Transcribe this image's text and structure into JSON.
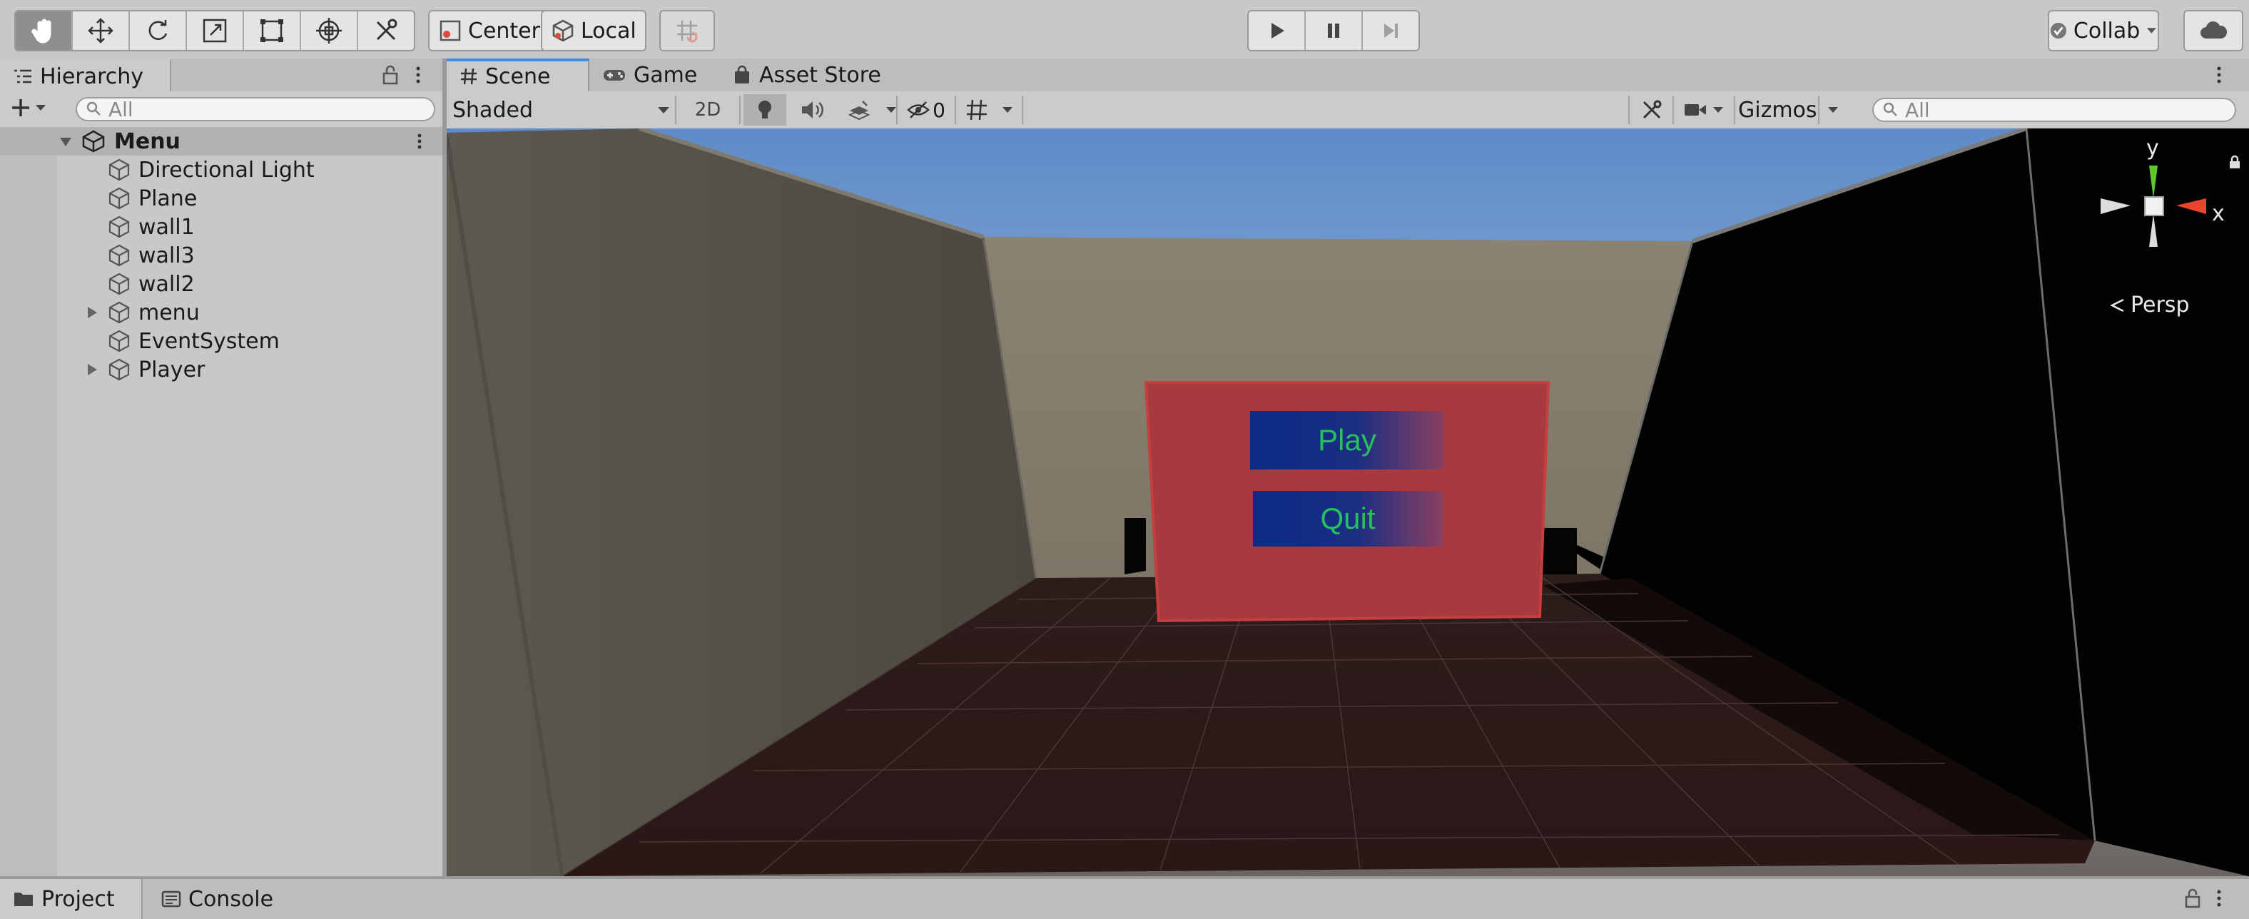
{
  "toolbar": {
    "tools": [
      "hand-tool",
      "move-tool",
      "rotate-tool",
      "scale-tool",
      "rect-tool",
      "transform-tool",
      "custom-tool"
    ],
    "pivot_label": "Center",
    "space_label": "Local",
    "collab_label": "Collab"
  },
  "hierarchy": {
    "tab_label": "Hierarchy",
    "search_placeholder": "All",
    "scene_name": "Menu",
    "items": [
      {
        "label": "Directional Light",
        "expandable": false
      },
      {
        "label": "Plane",
        "expandable": false
      },
      {
        "label": "wall1",
        "expandable": false
      },
      {
        "label": "wall3",
        "expandable": false
      },
      {
        "label": "wall2",
        "expandable": false
      },
      {
        "label": "menu",
        "expandable": true
      },
      {
        "label": "EventSystem",
        "expandable": false
      },
      {
        "label": "Player",
        "expandable": true
      }
    ]
  },
  "scene_view": {
    "tabs": [
      "Scene",
      "Game",
      "Asset Store"
    ],
    "active_tab": "Scene",
    "draw_mode": "Shaded",
    "mode_2d_label": "2D",
    "hidden_count": "0",
    "gizmos_label": "Gizmos",
    "search_placeholder": "All",
    "axis_y": "y",
    "axis_x": "x",
    "projection_label": "Persp",
    "menu_buttons": [
      "Play",
      "Quit"
    ]
  },
  "bottom": {
    "tabs": [
      "Project",
      "Console"
    ]
  },
  "colors": {
    "button_text": "#27c05d",
    "menu_panel": "#a8393e",
    "accent_blue": "#3d8ee0"
  }
}
